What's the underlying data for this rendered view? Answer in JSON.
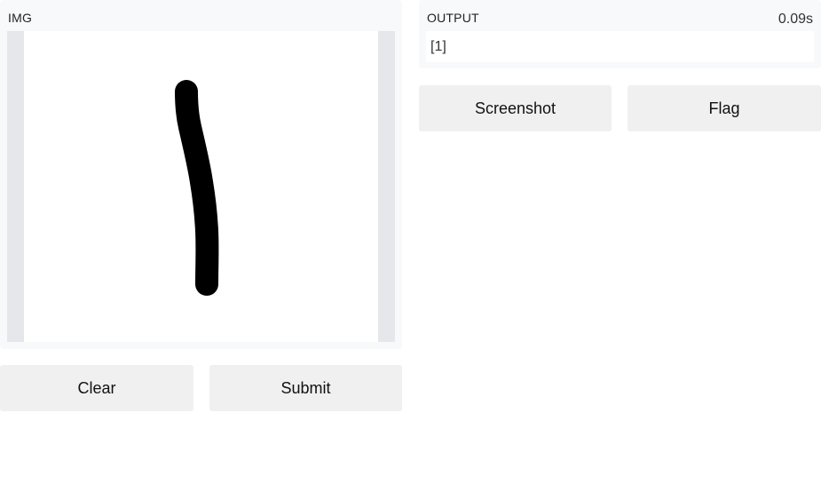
{
  "input": {
    "label": "IMG"
  },
  "output": {
    "label": "OUTPUT",
    "timer": "0.09s",
    "value": "[1]"
  },
  "buttons": {
    "clear": "Clear",
    "submit": "Submit",
    "screenshot": "Screenshot",
    "flag": "Flag"
  },
  "colors": {
    "panel_bg": "#f8f9fb",
    "button_bg": "#f0f0f0",
    "canvas_border": "#e5e7eb",
    "stroke": "#000000"
  }
}
